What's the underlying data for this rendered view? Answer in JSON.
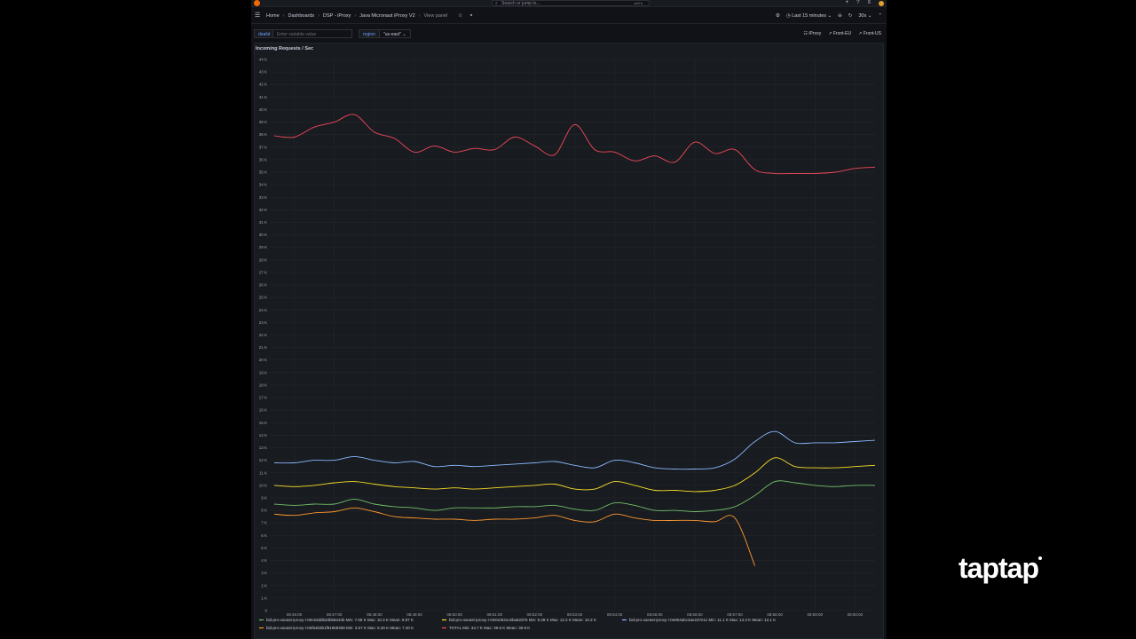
{
  "topbar": {
    "search_placeholder": "Search or jump to...",
    "search_shortcut": "ctrl+k",
    "icons": [
      "plus-icon",
      "help-icon",
      "rss-icon",
      "avatar"
    ]
  },
  "breadcrumbs": [
    "Home",
    "Dashboards",
    "DSP - iProxy",
    "Java Micronaut iProxy V2"
  ],
  "view_panel": "View panel",
  "time_range": "Last 15 minutes",
  "refresh_interval": "30s",
  "variables": {
    "dealid_label": "dealid",
    "dealid_placeholder": "Enter variable value",
    "region_label": "region",
    "region_value": "\"us-east\""
  },
  "links": [
    "iProxy",
    "Front-EU",
    "Front-US"
  ],
  "panel": {
    "title": "Incoming Requests / Sec"
  },
  "brand": {
    "name": "taptap"
  },
  "colors": {
    "total": "#f2495c",
    "series1": "#73bf69",
    "series2": "#fade2a",
    "series3": "#8ab8ff",
    "series4": "#ff9830"
  },
  "chart_data": {
    "type": "line",
    "title": "Incoming Requests / Sec",
    "ylim": [
      0,
      44000
    ],
    "y_ticks": [
      "0",
      "1 K",
      "2 K",
      "3 K",
      "4 K",
      "5 K",
      "6 K",
      "7 K",
      "8 K",
      "9 K",
      "10 K",
      "11 K",
      "12 K",
      "13 K",
      "14 K",
      "15 K",
      "16 K",
      "17 K",
      "18 K",
      "19 K",
      "20 K",
      "21 K",
      "22 K",
      "23 K",
      "24 K",
      "25 K",
      "26 K",
      "27 K",
      "28 K",
      "29 K",
      "30 K",
      "31 K",
      "32 K",
      "33 K",
      "34 K",
      "35 K",
      "36 K",
      "37 K",
      "38 K",
      "39 K",
      "40 K",
      "41 K",
      "42 K",
      "43 K",
      "44 K"
    ],
    "x": [
      "08:45:30",
      "08:46:00",
      "08:46:30",
      "08:47:00",
      "08:47:30",
      "08:48:00",
      "08:48:30",
      "08:49:00",
      "08:49:30",
      "08:50:00",
      "08:50:30",
      "08:51:00",
      "08:51:30",
      "08:52:00",
      "08:52:30",
      "08:53:00",
      "08:53:30",
      "08:54:00",
      "08:54:30",
      "08:55:00",
      "08:55:30",
      "08:56:00",
      "08:56:30",
      "08:57:00",
      "08:57:30",
      "08:58:00",
      "08:58:30",
      "08:59:00",
      "08:59:30",
      "09:00:00",
      "09:00:15"
    ],
    "x_ticks": [
      "08:46:00",
      "08:47:00",
      "08:48:00",
      "08:49:00",
      "08:50:00",
      "08:51:00",
      "08:52:00",
      "08:53:00",
      "08:54:00",
      "08:55:00",
      "08:56:00",
      "08:57:00",
      "08:58:00",
      "08:59:00",
      "09:00:00"
    ],
    "grid": true,
    "legend_position": "bottom",
    "series": [
      {
        "name": "bid-pro-useast-iproxy-i-00c63dd533bb8e34b",
        "color": "#73bf69",
        "legend_stats": "Min: 7.98 K  Max: 10.3 K  Mean: 8.87 K",
        "values": [
          8.5,
          8.4,
          8.5,
          8.5,
          8.9,
          8.5,
          8.3,
          8.2,
          8.0,
          8.2,
          8.2,
          8.2,
          8.3,
          8.3,
          8.4,
          8.1,
          8.0,
          8.6,
          8.4,
          8.0,
          8.0,
          7.9,
          8.0,
          8.3,
          9.2,
          10.3,
          10.2,
          10.0,
          9.9,
          10.0,
          10.0
        ]
      },
      {
        "name": "bid-pro-useast-iproxy-i-02810631c5ba62d76",
        "color": "#fade2a",
        "legend_stats": "Min: 9.38 K  Max: 12.2 K  Mean: 10.2 K",
        "values": [
          10.0,
          9.9,
          10.0,
          10.2,
          10.3,
          10.1,
          9.9,
          9.8,
          9.7,
          9.8,
          9.7,
          9.8,
          9.9,
          10.0,
          10.1,
          9.7,
          9.7,
          10.3,
          10.0,
          9.6,
          9.6,
          9.5,
          9.6,
          10.0,
          11.0,
          12.2,
          11.5,
          11.4,
          11.4,
          11.5,
          11.6
        ]
      },
      {
        "name": "bid-pro-useast-iproxy-i-0e804abc4ae237e11",
        "color": "#8ab8ff",
        "legend_stats": "Min: 11.1 K  Max: 14.3 K  Mean: 12.1 K",
        "values": [
          11.8,
          11.8,
          12.0,
          12.0,
          12.3,
          12.0,
          11.8,
          11.9,
          11.5,
          11.6,
          11.5,
          11.6,
          11.7,
          11.8,
          11.9,
          11.6,
          11.4,
          12.0,
          11.8,
          11.4,
          11.3,
          11.3,
          11.4,
          12.1,
          13.5,
          14.3,
          13.4,
          13.4,
          13.4,
          13.5,
          13.6
        ]
      },
      {
        "name": "bid-pro-useast-iproxy-i-0ef64b3b1f91969308",
        "color": "#ff9830",
        "legend_stats": "Min: 3.57 K  Max: 8.26 K  Mean: 7.40 K",
        "values": [
          7.7,
          7.6,
          7.8,
          7.9,
          8.2,
          7.9,
          7.5,
          7.4,
          7.3,
          7.3,
          7.2,
          7.3,
          7.3,
          7.4,
          7.6,
          7.2,
          7.1,
          7.7,
          7.4,
          7.2,
          7.2,
          7.2,
          7.1,
          7.4,
          3.57
        ]
      },
      {
        "name": "TOTAL",
        "color": "#f2495c",
        "legend_stats": "Min: 34.7 K  Max: 39.6 K  Mean: 36.9 K",
        "values": [
          37.9,
          37.8,
          38.6,
          39.0,
          39.6,
          38.2,
          37.7,
          36.6,
          37.1,
          36.6,
          36.9,
          36.8,
          37.8,
          37.1,
          36.4,
          38.8,
          36.8,
          36.6,
          35.9,
          36.3,
          35.8,
          37.4,
          36.5,
          36.8,
          35.2,
          34.9,
          34.9,
          34.9,
          35.0,
          35.3,
          35.4
        ]
      }
    ]
  }
}
